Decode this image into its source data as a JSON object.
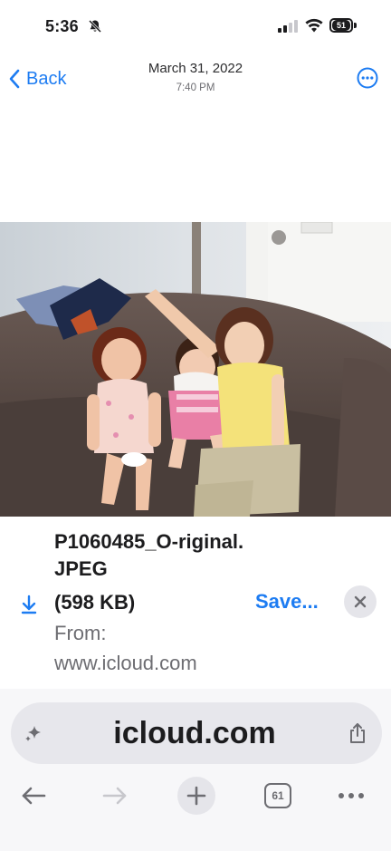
{
  "status_bar": {
    "time": "5:36",
    "battery_level": "51",
    "icons": [
      "bell-slash-icon",
      "signal-icon",
      "wifi-icon",
      "battery-icon"
    ]
  },
  "nav": {
    "back_label": "Back",
    "title": "March 31, 2022",
    "subtitle": "7:40 PM",
    "more_icon": "ellipsis-circle-icon"
  },
  "download": {
    "file_name": "P1060485_O-riginal.JPEG",
    "file_size": "(598 KB)",
    "from_label": "From:",
    "from_value": "www.icloud.com",
    "save_label": "Save...",
    "close_icon": "close-icon",
    "download_icon": "download-arrow-icon"
  },
  "address_bar": {
    "text": "icloud.com",
    "left_icon": "sparkle-icon",
    "right_icon": "share-icon"
  },
  "toolbar": {
    "tab_count": "61",
    "icons": [
      "back-arrow-icon",
      "forward-arrow-icon",
      "plus-icon",
      "tabs-icon",
      "more-dots-icon"
    ]
  },
  "colors": {
    "accent": "#1d7cf2",
    "secondary_text": "#6d6d72",
    "address_bar_bg": "#e7e7ec"
  }
}
